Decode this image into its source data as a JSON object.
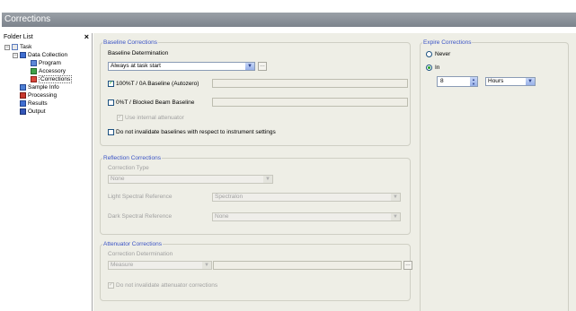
{
  "window": {
    "title": "Corrections"
  },
  "folder_list": {
    "header": "Folder List",
    "close_label": "×",
    "items": [
      {
        "label": "Task"
      },
      {
        "label": "Data Collection"
      },
      {
        "label": "Program"
      },
      {
        "label": "Accessory"
      },
      {
        "label": "Corrections"
      },
      {
        "label": "Sample Info"
      },
      {
        "label": "Processing"
      },
      {
        "label": "Results"
      },
      {
        "label": "Output"
      }
    ]
  },
  "baseline": {
    "title": "Baseline Corrections",
    "determination_label": "Baseline Determination",
    "determination_value": "Always at task start",
    "options": [
      {
        "label": "100%T / 0A Baseline (Autozero)",
        "checked": true
      },
      {
        "label": "0%T / Blocked Beam Baseline",
        "checked": false
      },
      {
        "label": "Use internal attenuator",
        "checked": true,
        "disabled": true
      },
      {
        "label": "Do not invalidate baselines with respect to instrument settings",
        "checked": false
      }
    ]
  },
  "reflection": {
    "title": "Reflection Corrections",
    "type_label": "Correction Type",
    "type_value": "None",
    "light_label": "Light Spectral Reference",
    "light_value": "Spectralon",
    "dark_label": "Dark Spectral Reference",
    "dark_value": "None"
  },
  "attenuator": {
    "title": "Attenuator Corrections",
    "determination_label": "Correction Determination",
    "determination_value": "Measure",
    "invalidate_label": "Do not invalidate attenuator corrections",
    "invalidate_checked": true
  },
  "expire": {
    "title": "Expire Corrections",
    "never_label": "Never",
    "in_label": "In",
    "in_selected": true,
    "amount": "8",
    "unit": "Hours"
  },
  "colors": {
    "group_title": "#3a53c5",
    "panel_bg": "#eeeee6",
    "titlebar": "#8a9099"
  }
}
